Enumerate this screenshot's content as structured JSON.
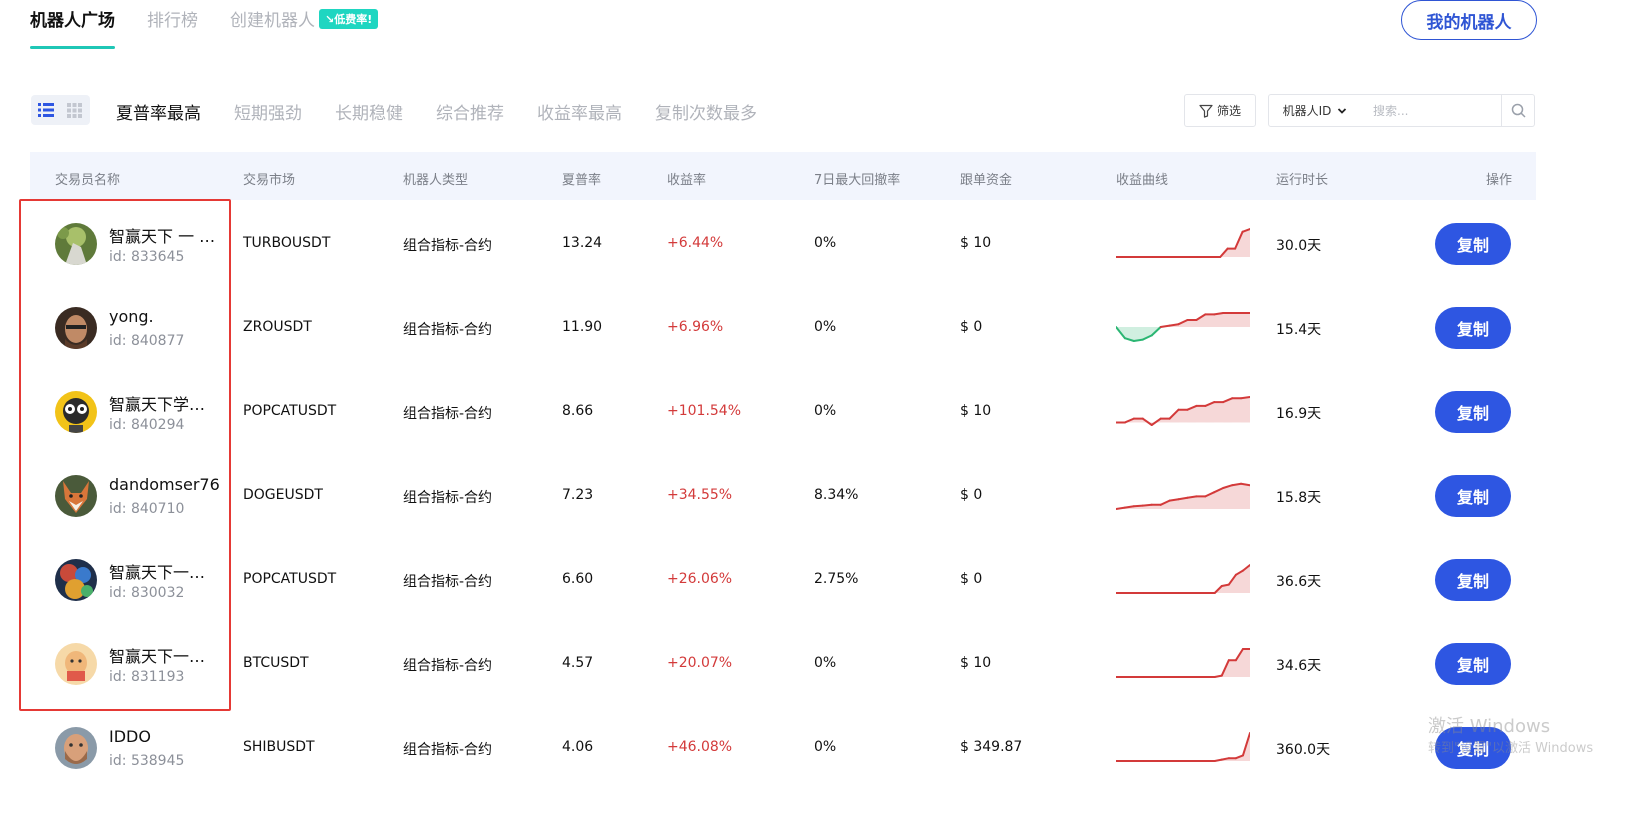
{
  "topnav": {
    "tabs": [
      {
        "label": "机器人广场",
        "active": true
      },
      {
        "label": "排行榜",
        "active": false
      },
      {
        "label": "创建机器人",
        "active": false
      }
    ],
    "badge": "↘低费率!",
    "my_bots": "我的机器人"
  },
  "sorts": [
    "夏普率最高",
    "短期强劲",
    "长期稳健",
    "综合推荐",
    "收益率最高",
    "复制次数最多"
  ],
  "filter": {
    "label": "筛选",
    "select": "机器人ID",
    "search_placeholder": "搜索..."
  },
  "columns": [
    "交易员名称",
    "交易市场",
    "机器人类型",
    "夏普率",
    "收益率",
    "7日最大回撤率",
    "跟单资金",
    "收益曲线",
    "运行时长",
    "操作"
  ],
  "rows": [
    {
      "name": "智赢天下 一 …",
      "id": "id: 833645",
      "market": "TURBOUSDT",
      "type": "组合指标-合约",
      "sharpe": "13.24",
      "return": "+6.44%",
      "drawdown": "0%",
      "fund": "$ 10",
      "duration": "30.0天",
      "action": "复制",
      "curve": [
        0,
        0,
        0,
        0,
        0,
        0,
        0,
        0,
        0,
        0,
        0,
        0,
        0,
        0,
        0,
        0.3,
        0.3,
        0.9,
        1.0
      ]
    },
    {
      "name": "yong.",
      "id": "id: 840877",
      "market": "ZROUSDT",
      "type": "组合指标-合约",
      "sharpe": "11.90",
      "return": "+6.96%",
      "drawdown": "0%",
      "fund": "$ 0",
      "duration": "15.4天",
      "action": "复制",
      "curve": [
        0,
        -0.8,
        -1.0,
        -0.9,
        -0.6,
        0,
        0.1,
        0.2,
        0.5,
        0.5,
        0.9,
        0.9,
        1.0,
        1.0,
        1.0,
        1.0
      ]
    },
    {
      "name": "智赢天下学…",
      "id": "id: 840294",
      "market": "POPCATUSDT",
      "type": "组合指标-合约",
      "sharpe": "8.66",
      "return": "+101.54%",
      "drawdown": "0%",
      "fund": "$ 10",
      "duration": "16.9天",
      "action": "复制",
      "curve": [
        0,
        0,
        0.15,
        0.15,
        -0.1,
        0.15,
        0.15,
        0.5,
        0.5,
        0.65,
        0.65,
        0.8,
        0.8,
        0.95,
        0.95,
        1.0
      ]
    },
    {
      "name": "dandomser76",
      "id": "id: 840710",
      "market": "DOGEUSDT",
      "type": "组合指标-合约",
      "sharpe": "7.23",
      "return": "+34.55%",
      "drawdown": "8.34%",
      "fund": "$ 0",
      "duration": "15.8天",
      "action": "复制",
      "curve": [
        0,
        0.05,
        0.1,
        0.12,
        0.15,
        0.15,
        0.3,
        0.35,
        0.4,
        0.45,
        0.45,
        0.6,
        0.75,
        0.85,
        0.9,
        0.85
      ]
    },
    {
      "name": "智赢天下一…",
      "id": "id: 830032",
      "market": "POPCATUSDT",
      "type": "组合指标-合约",
      "sharpe": "6.60",
      "return": "+26.06%",
      "drawdown": "2.75%",
      "fund": "$ 0",
      "duration": "36.6天",
      "action": "复制",
      "curve": [
        0,
        0,
        0,
        0,
        0,
        0,
        0,
        0,
        0,
        0,
        0,
        0,
        0,
        0,
        0,
        0.25,
        0.3,
        0.65,
        0.8,
        1.0
      ]
    },
    {
      "name": "智赢天下一…",
      "id": "id: 831193",
      "market": "BTCUSDT",
      "type": "组合指标-合约",
      "sharpe": "4.57",
      "return": "+20.07%",
      "drawdown": "0%",
      "fund": "$ 10",
      "duration": "34.6天",
      "action": "复制",
      "curve": [
        0,
        0,
        0,
        0,
        0,
        0,
        0,
        0,
        0,
        0,
        0,
        0,
        0,
        0,
        0,
        0.05,
        0.6,
        0.6,
        1.0,
        1.0
      ]
    },
    {
      "name": "IDDO",
      "id": "id: 538945",
      "market": "SHIBUSDT",
      "type": "组合指标-合约",
      "sharpe": "4.06",
      "return": "+46.08%",
      "drawdown": "0%",
      "fund": "$ 349.87",
      "duration": "360.0天",
      "action": "复制",
      "curve": [
        0,
        0,
        0,
        0,
        0,
        0,
        0,
        0,
        0,
        0,
        0,
        0,
        0,
        0,
        0,
        0.05,
        0.1,
        0.1,
        0.2,
        1.0
      ]
    }
  ],
  "watermark": {
    "line1": "激活 Windows",
    "line2": "转到\"设置\"以激活 Windows"
  },
  "colors": {
    "accent": "#2e56e2",
    "positive": "#d33a3a",
    "negative": "#2bb673",
    "tab_underline": "#1fc7b6",
    "highlight": "#e53935"
  }
}
